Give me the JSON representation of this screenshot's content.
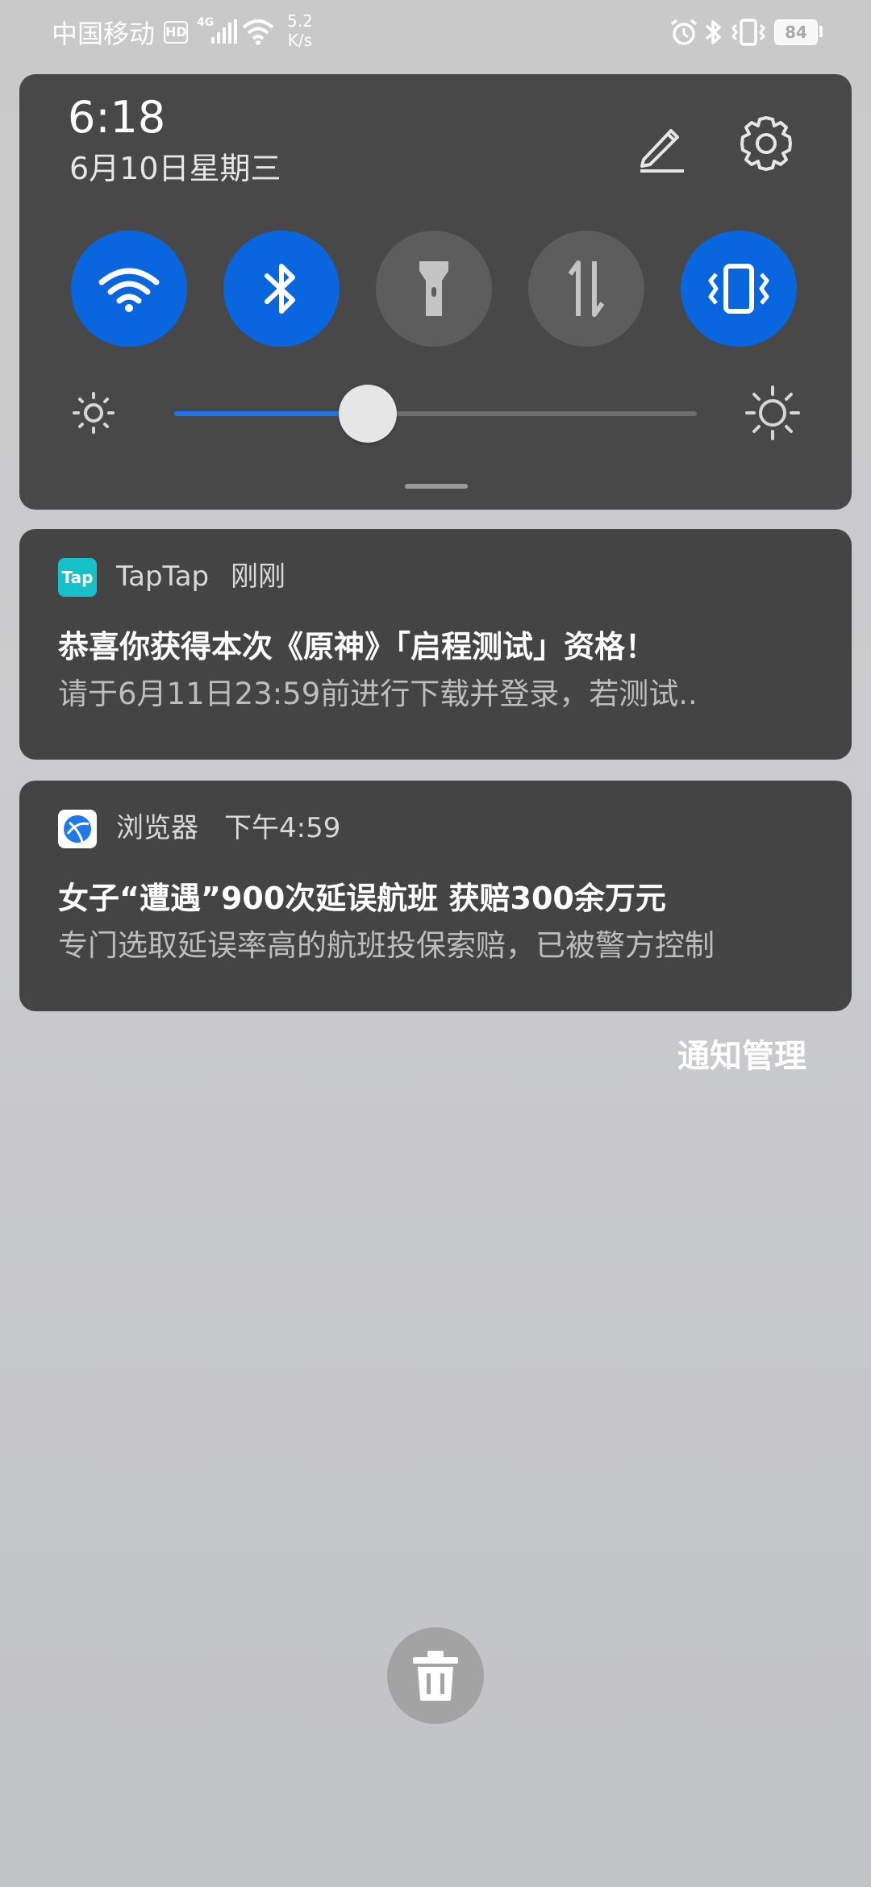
{
  "status_bar": {
    "carrier": "中国移动",
    "hd_badge": "HD",
    "network_type": "4G",
    "speed_value": "5.2",
    "speed_unit": "K/s",
    "battery_level": "84",
    "icons": [
      "signal-icon",
      "wifi-icon",
      "alarm-icon",
      "bluetooth-icon",
      "vibrate-icon",
      "battery-icon"
    ]
  },
  "quick_settings": {
    "time": "6:18",
    "date": "6月10日星期三",
    "toggles": [
      {
        "name": "wifi",
        "icon": "wifi-icon",
        "state": "on"
      },
      {
        "name": "bluetooth",
        "icon": "bluetooth-icon",
        "state": "on"
      },
      {
        "name": "flashlight",
        "icon": "flashlight-icon",
        "state": "off"
      },
      {
        "name": "mobile-data",
        "icon": "data-transfer-icon",
        "state": "off"
      },
      {
        "name": "vibrate",
        "icon": "vibrate-icon",
        "state": "on"
      }
    ],
    "brightness_fraction": 0.37,
    "colors": {
      "accent": "#0a66de",
      "panel": "#484848",
      "toggle_off": "#5d5d5d"
    }
  },
  "notifications": [
    {
      "app": "TapTap",
      "icon_label": "Tap",
      "time": "刚刚",
      "title": "恭喜你获得本次《原神》「启程测试」资格！",
      "body": "请于6月11日23:59前进行下载并登录，若测试.."
    },
    {
      "app": "浏览器",
      "time": "下午4:59",
      "title": "女子“遭遇”900次延误航班 获赔300余万元",
      "body": "专门选取延误率高的航班投保索赔，已被警方控制"
    }
  ],
  "manage_label": "通知管理"
}
